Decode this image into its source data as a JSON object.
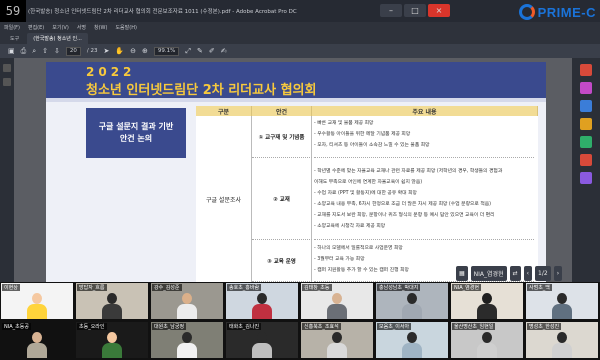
{
  "titlebar": {
    "clock": "59",
    "title": "(한국발송) 청소년 인터넷드림단 2차 리더교사 협의회 전문보조자료 1011 (수정본).pdf - Adobe Acrobat Pro DC",
    "minimize": "–",
    "maximize": "□",
    "close": "×"
  },
  "logo": {
    "text": "PRIME-C"
  },
  "menubar": {
    "items": [
      "파일(F)",
      "편집(E)",
      "보기(V)",
      "서명",
      "창(W)",
      "도움말(H)"
    ]
  },
  "tabs": [
    {
      "label": "도구"
    },
    {
      "label": "(한국발송) 청소년 인..."
    }
  ],
  "toolbar": {
    "page_current": "20",
    "page_total": "/ 23",
    "zoom": "99.1%"
  },
  "slide": {
    "year": "2022",
    "title": "청소년 인터넷드림단 2차 리더교사 협의회",
    "side_box": [
      "구글 설문지 결과 기반",
      "안건 논의"
    ]
  },
  "table": {
    "headers": [
      "구분",
      "안건",
      "주요 내용"
    ],
    "category": "구글 설문조사",
    "rows": [
      {
        "label": "① 교구재 및 기념품",
        "items": [
          "- 빠른 교재 및 물품 제공 희망",
          "- 우수활동 아이들을 위한 메달 기념품 제공 희망",
          "- 모자, 티셔츠 등 아이들이 소속감 느낄 수 있는 물품 희망"
        ]
      },
      {
        "label": "② 교재",
        "items": [
          "- 학년별 수준에 맞는 자율교육 교재나 관련 자료를 제공 희망 (저학년의 경우, 학생들의 경험과",
          "이해도 부족으로 어인에 연계한 자율교육이 쉽지 않음)",
          "- 수업 자료 (PPT 및 활동지)에 대한 공유 확대 희망",
          "- 소양교육 내용 부족, 6차시 한정으로 조금 더 많은 차시 제공 희망 (수업 분량으로 적음)",
          "- 교재를 지도서 보완 희망, 문항이나 퀴즈 형식의 문항 등 예시 답안 있으면 교육이 더 편리",
          "- 소양교육에 시청각 자료 제공 희망"
        ]
      },
      {
        "label": "③ 교육 운영",
        "items": [
          "- 하나의 모델에서 일률적으로 사업운영 희망",
          "- 3월부터 교육 가능 희망",
          "- 캠퍼 지원활동 추가 할 수 있는 캠퍼 진행 희망"
        ]
      }
    ]
  },
  "zoom_controls": {
    "name_tag": "NIA_염경현",
    "page": "1/2"
  },
  "participants": [
    {
      "name": "이현상",
      "shirt": "#ffd43b",
      "head": "#f5c8a0",
      "bg": "#f4f4f4"
    },
    {
      "name": "망답자_흐름",
      "shirt": "#3a3a3a",
      "head": "#2a2a2a",
      "bg": "#c9c2b5"
    },
    {
      "name": "강수_김성준",
      "shirt": "#ececec",
      "head": "#dbb08a",
      "bg": "#9b9890"
    },
    {
      "name": "송호초_홍바람",
      "shirt": "#c03040",
      "head": "#2a2a2a",
      "bg": "#cfd7e0"
    },
    {
      "name": "김태창_초등",
      "shirt": "#6b6f76",
      "head": "#d8b393",
      "bg": "#e8e8e8"
    },
    {
      "name": "충남성남초_박대지",
      "shirt": "#a0a8b2",
      "head": "#2a2a2a",
      "bg": "#aeb5bd"
    },
    {
      "name": "NIA_염경현",
      "shirt": "#2b2b2b",
      "head": "#1f1f1f",
      "bg": "#e6e0d6"
    },
    {
      "name": "사범초_백",
      "shirt": "#607080",
      "head": "#2a2a2a",
      "bg": "#dde2e8"
    },
    {
      "name": "NIA_초등공",
      "shirt": "#b0a898",
      "head": "#d8b393",
      "bg": "#111111"
    },
    {
      "name": "초등_오라인",
      "shirt": "#3a7a3a",
      "head": "#f5c8a0",
      "bg": "#1a1a1a"
    },
    {
      "name": "대원초_남궁정",
      "shirt": "#f2f2f2",
      "head": "#2a2a2a",
      "bg": "#7f7f75"
    },
    {
      "name": "태화초_김나진",
      "shirt": "#bfbfbf",
      "head": "#2a2a2a",
      "bg": "#2a2a2a"
    },
    {
      "name": "신흥북초_조효석",
      "shirt": "#d9d9d9",
      "head": "#2a2a2a",
      "bg": "#b7b2a8"
    },
    {
      "name": "모음초_이서아",
      "shirt": "#9fb4c4",
      "head": "#2a2a2a",
      "bg": "#c9d6de"
    },
    {
      "name": "울산명산초_임현일",
      "shirt": "#cfcfcf",
      "head": "#2a2a2a",
      "bg": "#c8c8c8"
    },
    {
      "name": "명성초_한성진",
      "shirt": "#d0d0d0",
      "head": "#2a2a2a",
      "bg": "#dcd8d0"
    }
  ]
}
